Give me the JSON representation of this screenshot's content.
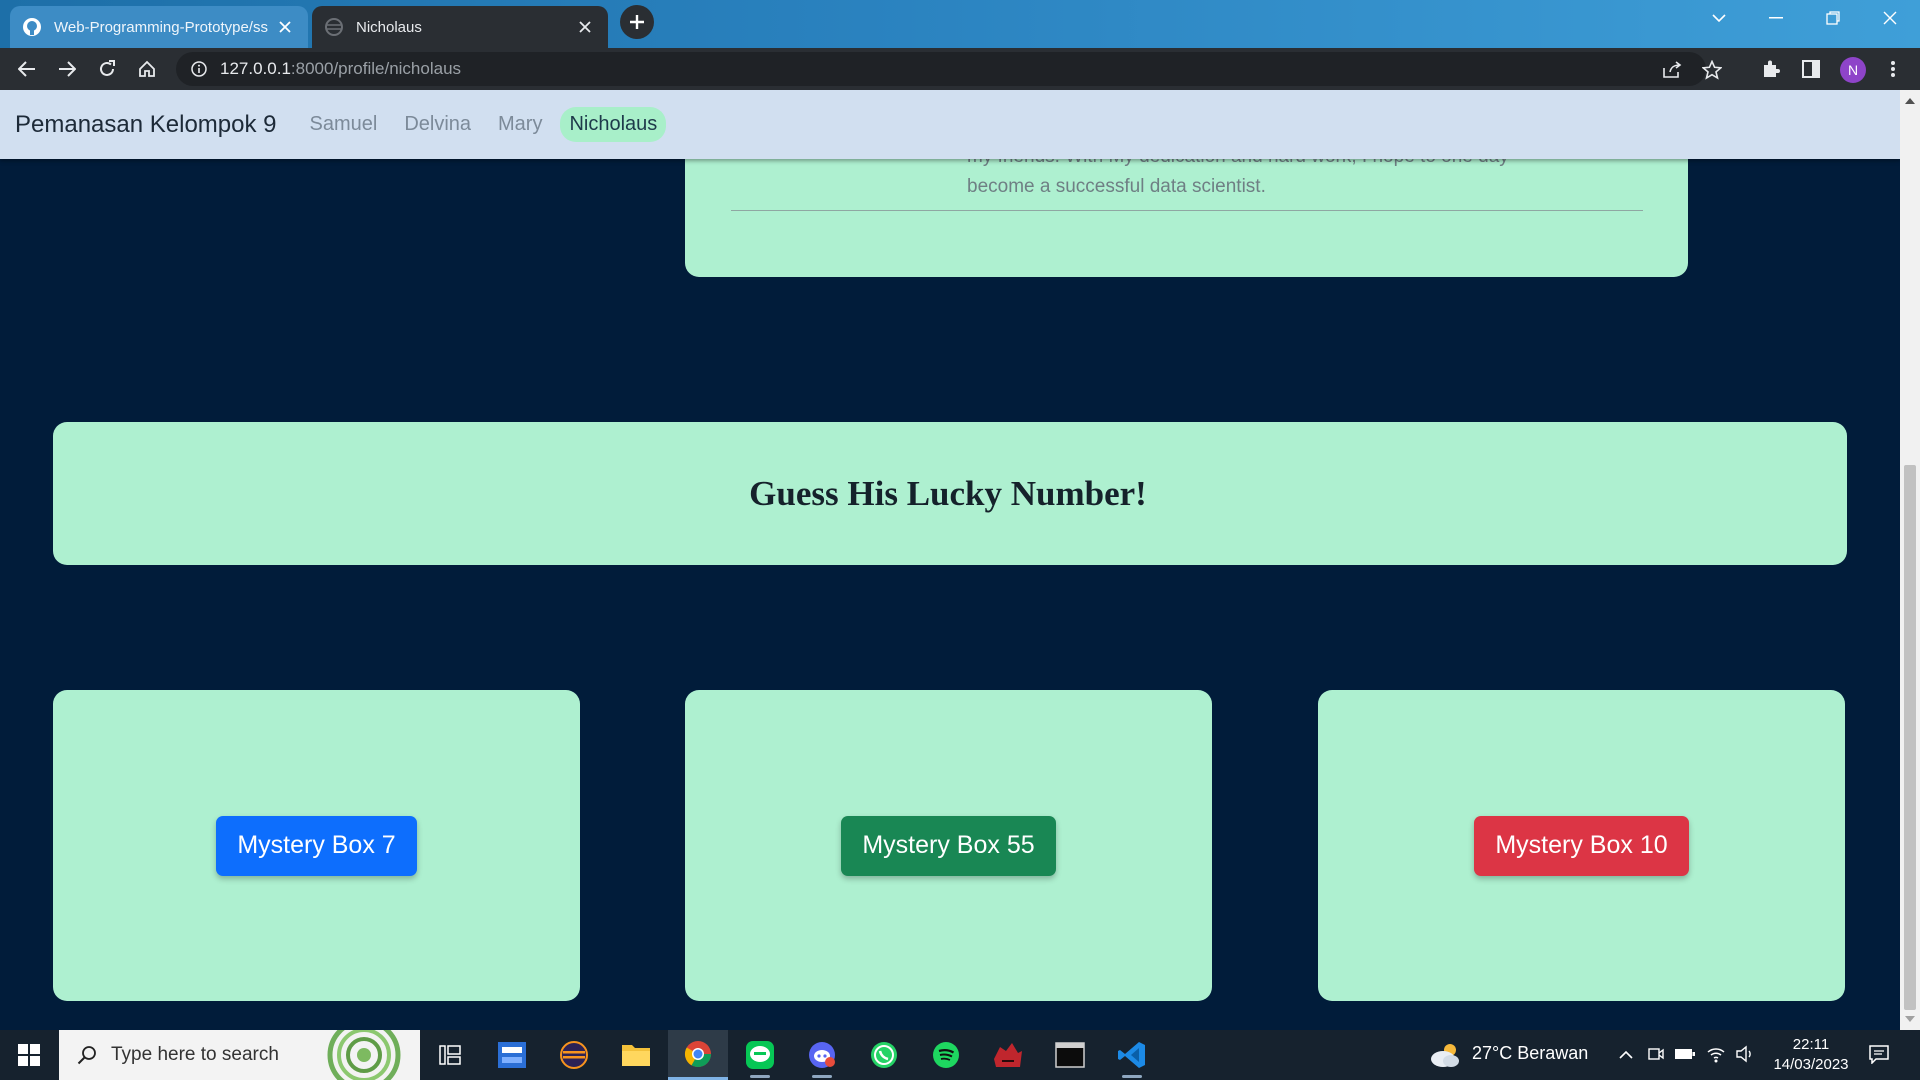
{
  "browser": {
    "tabs": [
      {
        "title": "Web-Programming-Prototype/ss",
        "favicon": "github-icon",
        "active": false
      },
      {
        "title": "Nicholaus",
        "favicon": "globe-icon",
        "active": true
      }
    ],
    "url_host": "127.0.0.1",
    "url_path": ":8000/profile/nicholaus",
    "profile_initial": "N"
  },
  "site": {
    "brand": "Pemanasan Kelompok 9",
    "nav": [
      {
        "label": "Samuel",
        "active": false
      },
      {
        "label": "Delvina",
        "active": false
      },
      {
        "label": "Mary",
        "active": false
      },
      {
        "label": "Nicholaus",
        "active": true
      }
    ],
    "bio_lines": [
      "my friends. With My dedication and hard work, I hope to one day",
      "become a successful data scientist."
    ],
    "lucky_title": "Guess His Lucky Number!",
    "boxes": [
      {
        "label": "Mystery Box 7",
        "color": "#0d6efd"
      },
      {
        "label": "Mystery Box 55",
        "color": "#198754"
      },
      {
        "label": "Mystery Box 10",
        "color": "#dc3545"
      }
    ],
    "accent": "#aef0d0",
    "background": "#011c3a"
  },
  "taskbar": {
    "search_placeholder": "Type here to search",
    "weather": "27°C  Berawan",
    "time": "22:11",
    "date": "14/03/2023",
    "apps": [
      "task-view-icon",
      "dev-icon",
      "eclipse-icon",
      "file-explorer-icon",
      "chrome-icon",
      "line-icon",
      "discord-icon",
      "whatsapp-icon",
      "spotify-icon",
      "app-icon",
      "terminal-icon",
      "vscode-icon"
    ]
  }
}
